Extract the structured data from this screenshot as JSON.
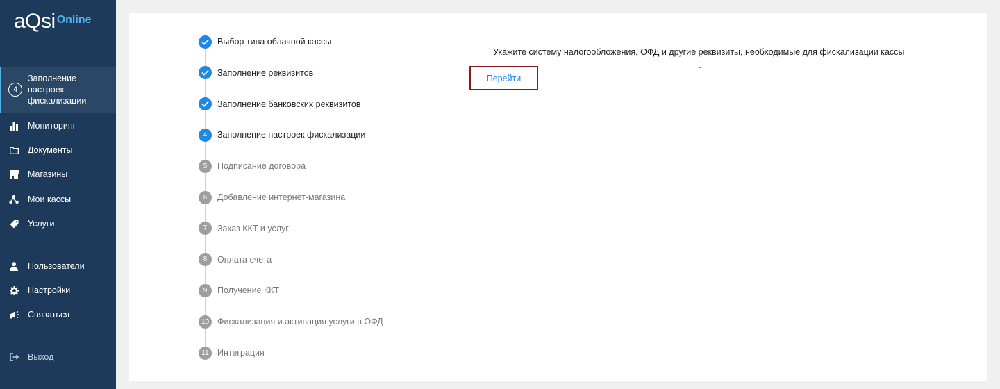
{
  "brand": {
    "logo_main": "aQsi",
    "logo_sub": "Online",
    "accent": "#4fb3e8",
    "sidebar_bg": "#1e3a5a"
  },
  "sidebar": {
    "active": {
      "step_number": "4",
      "label": "Заполнение настроек фискализации"
    },
    "items": [
      {
        "label": "Мониторинг",
        "icon": "bar-chart-icon"
      },
      {
        "label": "Документы",
        "icon": "folder-icon"
      },
      {
        "label": "Магазины",
        "icon": "store-icon"
      },
      {
        "label": "Мои кассы",
        "icon": "network-icon"
      },
      {
        "label": "Услуги",
        "icon": "tag-icon"
      },
      {
        "label": "Пользователи",
        "icon": "user-icon"
      },
      {
        "label": "Настройки",
        "icon": "gear-icon"
      },
      {
        "label": "Связаться",
        "icon": "megaphone-icon"
      }
    ],
    "logout": {
      "label": "Выход",
      "icon": "logout-icon"
    }
  },
  "steps": [
    {
      "num": "1",
      "label": "Выбор типа облачной кассы",
      "state": "done"
    },
    {
      "num": "2",
      "label": "Заполнение реквизитов",
      "state": "done"
    },
    {
      "num": "3",
      "label": "Заполнение банковских реквизитов",
      "state": "done"
    },
    {
      "num": "4",
      "label": "Заполнение настроек фискализации",
      "state": "current"
    },
    {
      "num": "5",
      "label": "Подписание договора",
      "state": "todo"
    },
    {
      "num": "6",
      "label": "Добавление интернет-магазина",
      "state": "todo"
    },
    {
      "num": "7",
      "label": "Заказ ККТ и услуг",
      "state": "todo"
    },
    {
      "num": "8",
      "label": "Оплата счета",
      "state": "todo"
    },
    {
      "num": "9",
      "label": "Получение ККТ",
      "state": "todo"
    },
    {
      "num": "10",
      "label": "Фискализация и активация услуги в ОФД",
      "state": "todo"
    },
    {
      "num": "11",
      "label": "Интеграция",
      "state": "todo"
    }
  ],
  "main": {
    "info_text": "Укажите систему налогообложения, ОФД и другие реквизиты, необходимые для фискализации кассы",
    "go_button": "Перейти"
  }
}
